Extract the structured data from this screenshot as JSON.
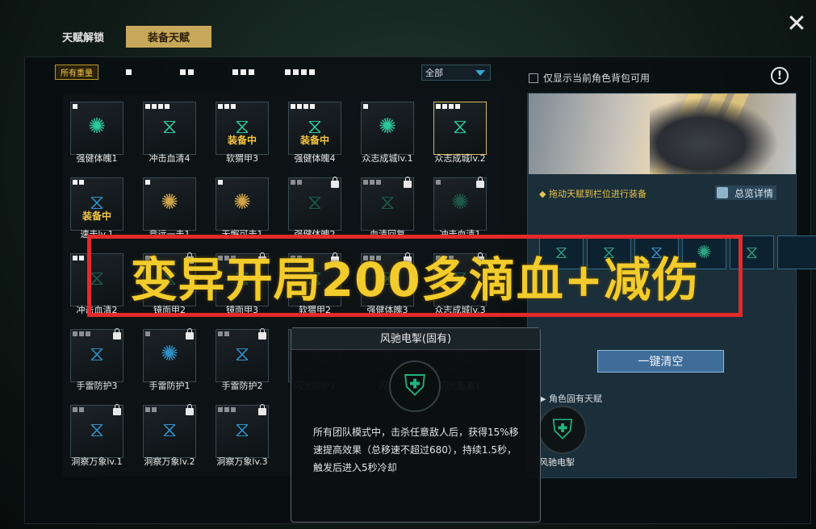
{
  "tabs": [
    {
      "label": "天赋解锁",
      "active": false
    },
    {
      "label": "装备天赋",
      "active": true
    }
  ],
  "filters": {
    "all_label": "所有重量",
    "weight_filters": [
      1,
      2,
      3,
      4
    ],
    "select_value": "全部"
  },
  "talents": [
    {
      "name": "强健体魄1",
      "dots": 1,
      "dim": 0,
      "locked": false,
      "equipped": false,
      "icon": "compass-icon",
      "tone": "green",
      "glyph": "✺",
      "selected": false
    },
    {
      "name": "冲击血清4",
      "dots": 4,
      "dim": 0,
      "locked": false,
      "equipped": false,
      "icon": "dna-icon",
      "tone": "green",
      "glyph": "⧖",
      "selected": false
    },
    {
      "name": "软猬甲3",
      "dots": 3,
      "dim": 0,
      "locked": false,
      "equipped": true,
      "icon": "dna-icon",
      "tone": "green",
      "glyph": "⧖",
      "selected": false
    },
    {
      "name": "强健体魄4",
      "dots": 4,
      "dim": 0,
      "locked": false,
      "equipped": true,
      "icon": "dna-icon",
      "tone": "green",
      "glyph": "⧖",
      "selected": false
    },
    {
      "name": "众志成城lv.1",
      "dots": 1,
      "dim": 0,
      "locked": false,
      "equipped": false,
      "icon": "compass-icon",
      "tone": "green",
      "glyph": "✺",
      "selected": false
    },
    {
      "name": "众志成城lv.2",
      "dots": 4,
      "dim": 0,
      "locked": false,
      "equipped": false,
      "icon": "dna-icon",
      "tone": "green",
      "glyph": "⧖",
      "selected": true
    },
    {
      "name": "速击lv.1",
      "dots": 2,
      "dim": 0,
      "locked": false,
      "equipped": true,
      "icon": "dna-icon",
      "tone": "blue",
      "glyph": "⧖",
      "selected": false
    },
    {
      "name": "竞远一击1",
      "dots": 1,
      "dim": 0,
      "locked": false,
      "equipped": false,
      "icon": "compass-icon",
      "tone": "gold",
      "glyph": "✺",
      "selected": false
    },
    {
      "name": "无懈可击1",
      "dots": 1,
      "dim": 0,
      "locked": false,
      "equipped": false,
      "icon": "compass-icon",
      "tone": "gold",
      "glyph": "✺",
      "selected": false
    },
    {
      "name": "强健体魄2",
      "dots": 2,
      "dim": 2,
      "locked": true,
      "equipped": false,
      "icon": "dna-icon",
      "tone": "dark",
      "glyph": "⧖",
      "selected": false
    },
    {
      "name": "血清回复",
      "dots": 3,
      "dim": 3,
      "locked": true,
      "equipped": false,
      "icon": "dna-icon",
      "tone": "dark",
      "glyph": "⧖",
      "selected": false
    },
    {
      "name": "冲击血清1",
      "dots": 1,
      "dim": 1,
      "locked": true,
      "equipped": false,
      "icon": "compass-icon",
      "tone": "dark",
      "glyph": "✺",
      "selected": false
    },
    {
      "name": "冲击血清2",
      "dots": 2,
      "dim": 0,
      "locked": false,
      "equipped": false,
      "icon": "dna-icon",
      "tone": "dark",
      "glyph": "⧖",
      "selected": false
    },
    {
      "name": "镜面甲2",
      "dots": 2,
      "dim": 2,
      "locked": true,
      "equipped": false,
      "icon": "dna-icon",
      "tone": "dark",
      "glyph": "⧖",
      "selected": false
    },
    {
      "name": "镜面甲3",
      "dots": 3,
      "dim": 3,
      "locked": true,
      "equipped": false,
      "icon": "dna-icon",
      "tone": "dark",
      "glyph": "⧖",
      "selected": false
    },
    {
      "name": "软猬甲2",
      "dots": 2,
      "dim": 2,
      "locked": true,
      "equipped": false,
      "icon": "dna-icon",
      "tone": "dark",
      "glyph": "⧖",
      "selected": false
    },
    {
      "name": "强健体魄3",
      "dots": 3,
      "dim": 3,
      "locked": true,
      "equipped": false,
      "icon": "dna-icon",
      "tone": "dark",
      "glyph": "⧖",
      "selected": false
    },
    {
      "name": "众志成城lv.3",
      "dots": 3,
      "dim": 3,
      "locked": true,
      "equipped": false,
      "icon": "dna-icon",
      "tone": "dark",
      "glyph": "⧖",
      "selected": false
    },
    {
      "name": "手雷防护3",
      "dots": 3,
      "dim": 3,
      "locked": true,
      "equipped": false,
      "icon": "dna-icon",
      "tone": "blue",
      "glyph": "⧖",
      "selected": false
    },
    {
      "name": "手雷防护1",
      "dots": 1,
      "dim": 1,
      "locked": true,
      "equipped": false,
      "icon": "compass-icon",
      "tone": "blue",
      "glyph": "✺",
      "selected": false
    },
    {
      "name": "手雷防护2",
      "dots": 2,
      "dim": 2,
      "locked": true,
      "equipped": false,
      "icon": "dna-icon",
      "tone": "blue",
      "glyph": "⧖",
      "selected": false
    },
    {
      "name": "闪光防护1",
      "dots": 1,
      "dim": 1,
      "locked": true,
      "equipped": false,
      "icon": "dna-icon",
      "tone": "dark",
      "glyph": "⧖",
      "selected": false
    },
    {
      "name": "闪光",
      "dots": 2,
      "dim": 2,
      "locked": true,
      "equipped": false,
      "icon": "dna-icon",
      "tone": "dark",
      "glyph": "⧖",
      "selected": false
    },
    {
      "name": "闪光距离1",
      "dots": 1,
      "dim": 1,
      "locked": true,
      "equipped": false,
      "icon": "dna-icon",
      "tone": "dark",
      "glyph": "⧖",
      "selected": false
    },
    {
      "name": "洞察万象lv.1",
      "dots": 2,
      "dim": 2,
      "locked": true,
      "equipped": false,
      "icon": "dna-icon",
      "tone": "blue",
      "glyph": "⧖",
      "selected": false
    },
    {
      "name": "洞察万象lv.2",
      "dots": 2,
      "dim": 2,
      "locked": true,
      "equipped": false,
      "icon": "dna-icon",
      "tone": "blue",
      "glyph": "⧖",
      "selected": false
    },
    {
      "name": "洞察万象lv.3",
      "dots": 3,
      "dim": 3,
      "locked": true,
      "equipped": false,
      "icon": "dna-icon",
      "tone": "blue",
      "glyph": "⧖",
      "selected": false
    }
  ],
  "equip_label": "装备中",
  "right": {
    "backpack_checkbox": "仅显示当前角色背包可用",
    "info_icon": "!",
    "drag_hint": "◆ 拖动天赋到栏位进行装备",
    "overview_label": "总览详情",
    "slots": [
      "⧖",
      "⧖",
      "⧖",
      "✺",
      "⧖",
      ""
    ],
    "clear_label": "一键清空",
    "innate_label": "▶ 角色固有天赋",
    "innate_name": "风驰电掣"
  },
  "tooltip": {
    "title": "风驰电掣(固有)",
    "description": "所有团队模式中，击杀任意敌人后，获得15%移速提高效果（总移速不超过680），持续1.5秒，触发后进入5秒冷却"
  },
  "banner": "变异开局200多滴血+减伤",
  "colors": {
    "accent_gold": "#c7a85a",
    "equip_yellow": "#f4c643",
    "banner_border": "#e42a2a",
    "banner_text": "#f2cc2c",
    "clear_button": "#3e6d99"
  }
}
